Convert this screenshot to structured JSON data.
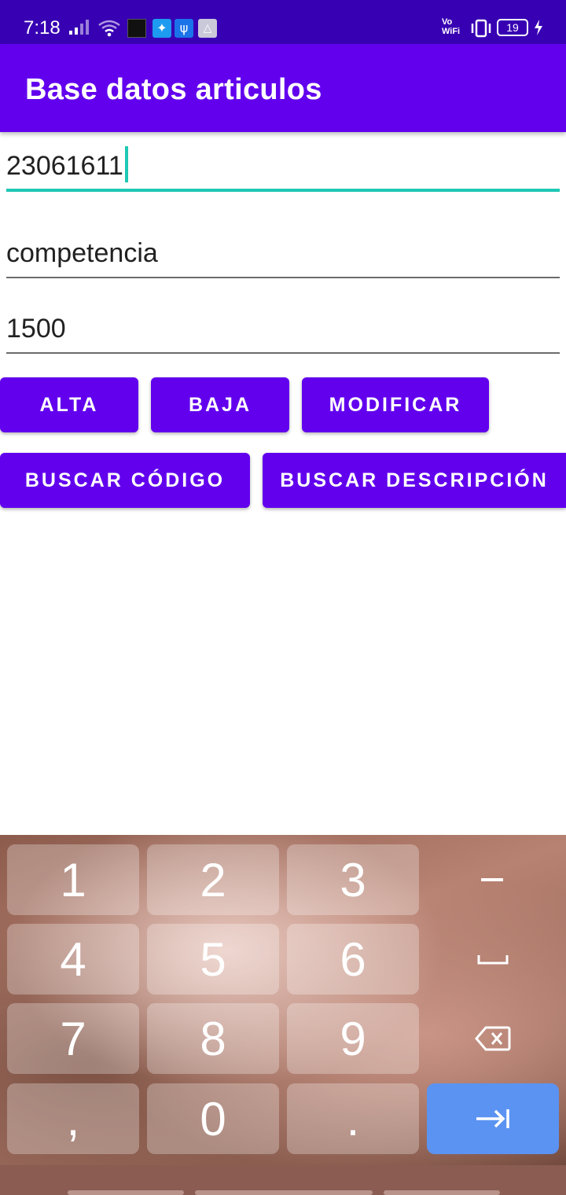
{
  "status_bar": {
    "time": "7:18",
    "battery": "19",
    "icons": [
      "signal-icon",
      "wifi-icon",
      "notification-app-icon",
      "twitter-icon",
      "usb-icon",
      "drive-icon",
      "vowifi-icon",
      "vibrate-icon",
      "battery-icon",
      "charging-icon"
    ]
  },
  "app_bar": {
    "title": "Base datos articulos"
  },
  "fields": {
    "code": {
      "value": "23061611"
    },
    "description": {
      "value": "competencia"
    },
    "price": {
      "value": "1500"
    }
  },
  "buttons": {
    "alta": "ALTA",
    "baja": "BAJA",
    "modificar": "MODIFICAR",
    "buscar_codigo": "BUSCAR CÓDIGO",
    "buscar_descripcion": "BUSCAR DESCRIPCIÓN"
  },
  "keyboard": {
    "keys": [
      "1",
      "2",
      "3",
      "4",
      "5",
      "6",
      "7",
      "8",
      "9",
      ",",
      "0",
      "."
    ],
    "side_keys": [
      "minus-key",
      "space-key",
      "backspace-key",
      "tab-key"
    ],
    "colors": {
      "enter": "#5b93f2"
    }
  },
  "colors": {
    "primary": "#6200EE",
    "primary_dark": "#3700B3",
    "accent": "#1ec8b4"
  }
}
